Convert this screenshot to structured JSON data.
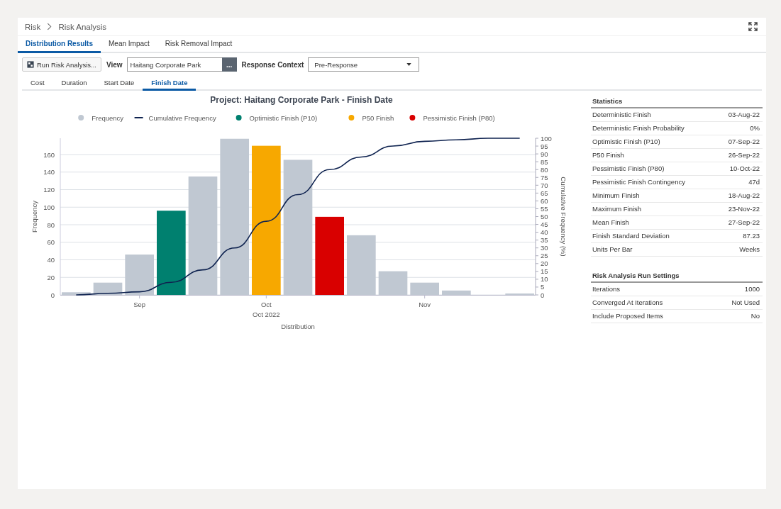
{
  "breadcrumb": [
    {
      "label": "Risk"
    },
    {
      "label": "Risk Analysis"
    }
  ],
  "tabs": [
    {
      "label": "Distribution Results",
      "selected": true
    },
    {
      "label": "Mean Impact",
      "selected": false
    },
    {
      "label": "Risk Removal Impact",
      "selected": false
    }
  ],
  "toolbar": {
    "run_button": "Run Risk Analysis...",
    "view_label": "View",
    "view_value": "Haitang Corporate Park",
    "browse_button": "...",
    "context_label": "Response Context",
    "context_value": "Pre-Response"
  },
  "subtabs": [
    {
      "label": "Cost",
      "selected": false
    },
    {
      "label": "Duration",
      "selected": false
    },
    {
      "label": "Start Date",
      "selected": false
    },
    {
      "label": "Finish Date",
      "selected": true
    }
  ],
  "chart": {
    "chart_data": {
      "type": "bar",
      "title": "Project: Haitang Corporate Park - Finish Date",
      "xlabel": "Distribution",
      "ylabel": "Frequency",
      "categories": [
        null,
        null,
        "Sep",
        null,
        null,
        null,
        "Oct",
        null,
        null,
        null,
        null,
        "Nov",
        null,
        null,
        null
      ],
      "annotations": [
        "Oct 2022"
      ],
      "ylim": [
        0,
        178.6
      ],
      "yticks": [
        0,
        20,
        40,
        60,
        80,
        100,
        120,
        140,
        160
      ],
      "grid": true,
      "legend": "top",
      "series": [
        {
          "name": "Frequency",
          "color": "#c0c8d2",
          "values": [
            3,
            14,
            46,
            null,
            135,
            178,
            null,
            154,
            null,
            68,
            27,
            14,
            5,
            0,
            1
          ]
        },
        {
          "name": "Optimistic Finish (P10)",
          "color": "#00806f",
          "values": [
            null,
            null,
            null,
            96,
            null,
            null,
            null,
            null,
            null,
            null,
            null,
            null,
            null,
            null,
            null
          ]
        },
        {
          "name": "P50 Finish",
          "color": "#f7a800",
          "values": [
            null,
            null,
            null,
            null,
            null,
            null,
            170,
            null,
            null,
            null,
            null,
            null,
            null,
            null,
            null
          ]
        },
        {
          "name": "Pessimistic Finish (P80)",
          "color": "#d90000",
          "values": [
            null,
            null,
            null,
            null,
            null,
            null,
            null,
            null,
            89,
            null,
            null,
            null,
            null,
            null,
            null
          ]
        }
      ]
    }
  },
  "cumulative_overlay": {
    "chart_data": {
      "type": "line",
      "ylabel": "Cumulative Frequency (%)",
      "ylim": [
        0,
        100
      ],
      "yticks": [
        0,
        5,
        10,
        15,
        20,
        25,
        30,
        35,
        40,
        45,
        50,
        55,
        60,
        65,
        70,
        75,
        80,
        85,
        90,
        95,
        100
      ],
      "series": [
        {
          "name": "Cumulative Frequency",
          "color": "#0f2350",
          "values": [
            0,
            1,
            2,
            8,
            16,
            30,
            47,
            64,
            80,
            88,
            95,
            98,
            99,
            100,
            100
          ]
        }
      ]
    }
  },
  "statistics": {
    "title": "Statistics",
    "rows": [
      {
        "label": "Deterministic Finish",
        "value": "03-Aug-22"
      },
      {
        "label": "Deterministic Finish Probability",
        "value": "0%"
      },
      {
        "label": "Optimistic Finish (P10)",
        "value": "07-Sep-22"
      },
      {
        "label": "P50 Finish",
        "value": "26-Sep-22"
      },
      {
        "label": "Pessimistic Finish (P80)",
        "value": "10-Oct-22"
      },
      {
        "label": "Pessimistic Finish Contingency",
        "value": "47d"
      },
      {
        "label": "Minimum Finish",
        "value": "18-Aug-22"
      },
      {
        "label": "Maximum Finish",
        "value": "23-Nov-22"
      },
      {
        "label": "Mean Finish",
        "value": "27-Sep-22"
      },
      {
        "label": "Finish Standard Deviation",
        "value": "87.23"
      },
      {
        "label": "Units Per Bar",
        "value": "Weeks"
      }
    ]
  },
  "run_settings": {
    "title": "Risk Analysis Run Settings",
    "rows": [
      {
        "label": "Iterations",
        "value": "1000"
      },
      {
        "label": "Converged At Iterations",
        "value": "Not Used"
      },
      {
        "label": "Include Proposed Items",
        "value": "No"
      }
    ]
  }
}
